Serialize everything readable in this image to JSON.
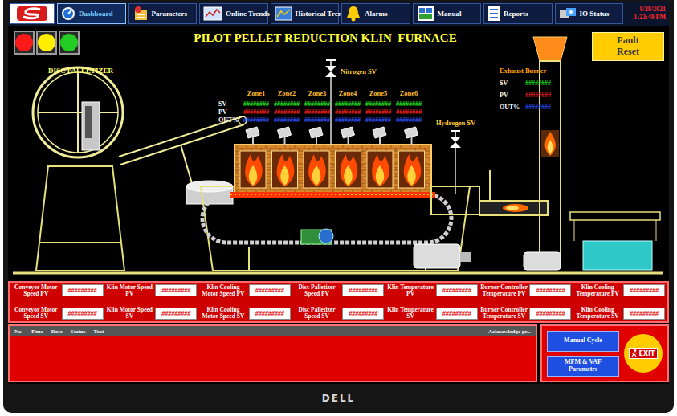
{
  "tabs": [
    {
      "label": "Dashboard",
      "selected": true
    },
    {
      "label": "Parameters",
      "selected": false
    },
    {
      "label": "Online Trends",
      "selected": false
    },
    {
      "label": "Historical Trends",
      "selected": false
    },
    {
      "label": "Alarms",
      "selected": false
    },
    {
      "label": "Manual",
      "selected": false
    },
    {
      "label": "Reports",
      "selected": false
    },
    {
      "label": "IO Status",
      "selected": false
    }
  ],
  "datetime": {
    "date": "8/28/2021",
    "time": "1:23:49 PM"
  },
  "lights": [
    {
      "color": "#ff1a1a"
    },
    {
      "color": "#ffee00"
    },
    {
      "color": "#22cc22"
    }
  ],
  "title": "PILOT PELLET REDUCTION KLIN  FURNACE",
  "fault_reset": "Fault Reset",
  "disc_label": "DISC PALLETIZER",
  "nitrogen_label": "Nitrogen SV",
  "hydrogen_label": "Hydrogen SV",
  "zones": {
    "headers": [
      "Zone1",
      "Zone2",
      "Zone3",
      "Zone4",
      "Zone5",
      "Zone6"
    ],
    "rows": [
      {
        "label": "SV",
        "color": "#22ee22",
        "values": [
          "########",
          "########",
          "########",
          "########",
          "########",
          "########"
        ]
      },
      {
        "label": "PV",
        "color": "#ff2222",
        "values": [
          "########",
          "########",
          "########",
          "########",
          "########",
          "########"
        ]
      },
      {
        "label": "OUT%",
        "color": "#3355ff",
        "values": [
          "########",
          "########",
          "########",
          "########",
          "########",
          "########"
        ]
      }
    ]
  },
  "exhaust": {
    "title": "Exhaust Burner",
    "rows": [
      {
        "label": "SV",
        "value": "########",
        "color": "#22ee22"
      },
      {
        "label": "PV",
        "value": "########",
        "color": "#ff2222"
      },
      {
        "label": "OUT%",
        "value": "########",
        "color": "#3355ff"
      }
    ]
  },
  "readings": {
    "rows": [
      [
        {
          "label": "Conveyor Motor Speed PV",
          "value": "#########"
        },
        {
          "label": "Klin Motor Speed PV",
          "value": "#########"
        },
        {
          "label": "Klin Cooling Motor Speed PV",
          "value": "#########"
        },
        {
          "label": "Disc Palletizer Speed PV",
          "value": "#########"
        },
        {
          "label": "Klin Temperature PV",
          "value": "#########"
        },
        {
          "label": "Burner Controller Temperature PV",
          "value": "#########"
        },
        {
          "label": "Klin Cooling Temperature PV",
          "value": "#########"
        }
      ],
      [
        {
          "label": "Conveyor Motor Speed SV",
          "value": "#########"
        },
        {
          "label": "Klin Motor Speed SV",
          "value": "#########"
        },
        {
          "label": "Klin Cooling Motor Speed SV",
          "value": "#########"
        },
        {
          "label": "Disc Palletizer Speed SV",
          "value": "#########"
        },
        {
          "label": "Klin Temperature SV",
          "value": "#########"
        },
        {
          "label": "Burner Controller Temperature SV",
          "value": "#########"
        },
        {
          "label": "Klin Cooling Temperature SV",
          "value": "#########"
        }
      ]
    ]
  },
  "alarms": {
    "columns": [
      "No.",
      "Time",
      "Date",
      "Status",
      "Text",
      "Acknowledge gr..."
    ],
    "rows": []
  },
  "buttons": [
    "Manual Cycle",
    "MFM & VAF Parametrs"
  ],
  "exit": "EXIT",
  "brand": "DELL"
}
